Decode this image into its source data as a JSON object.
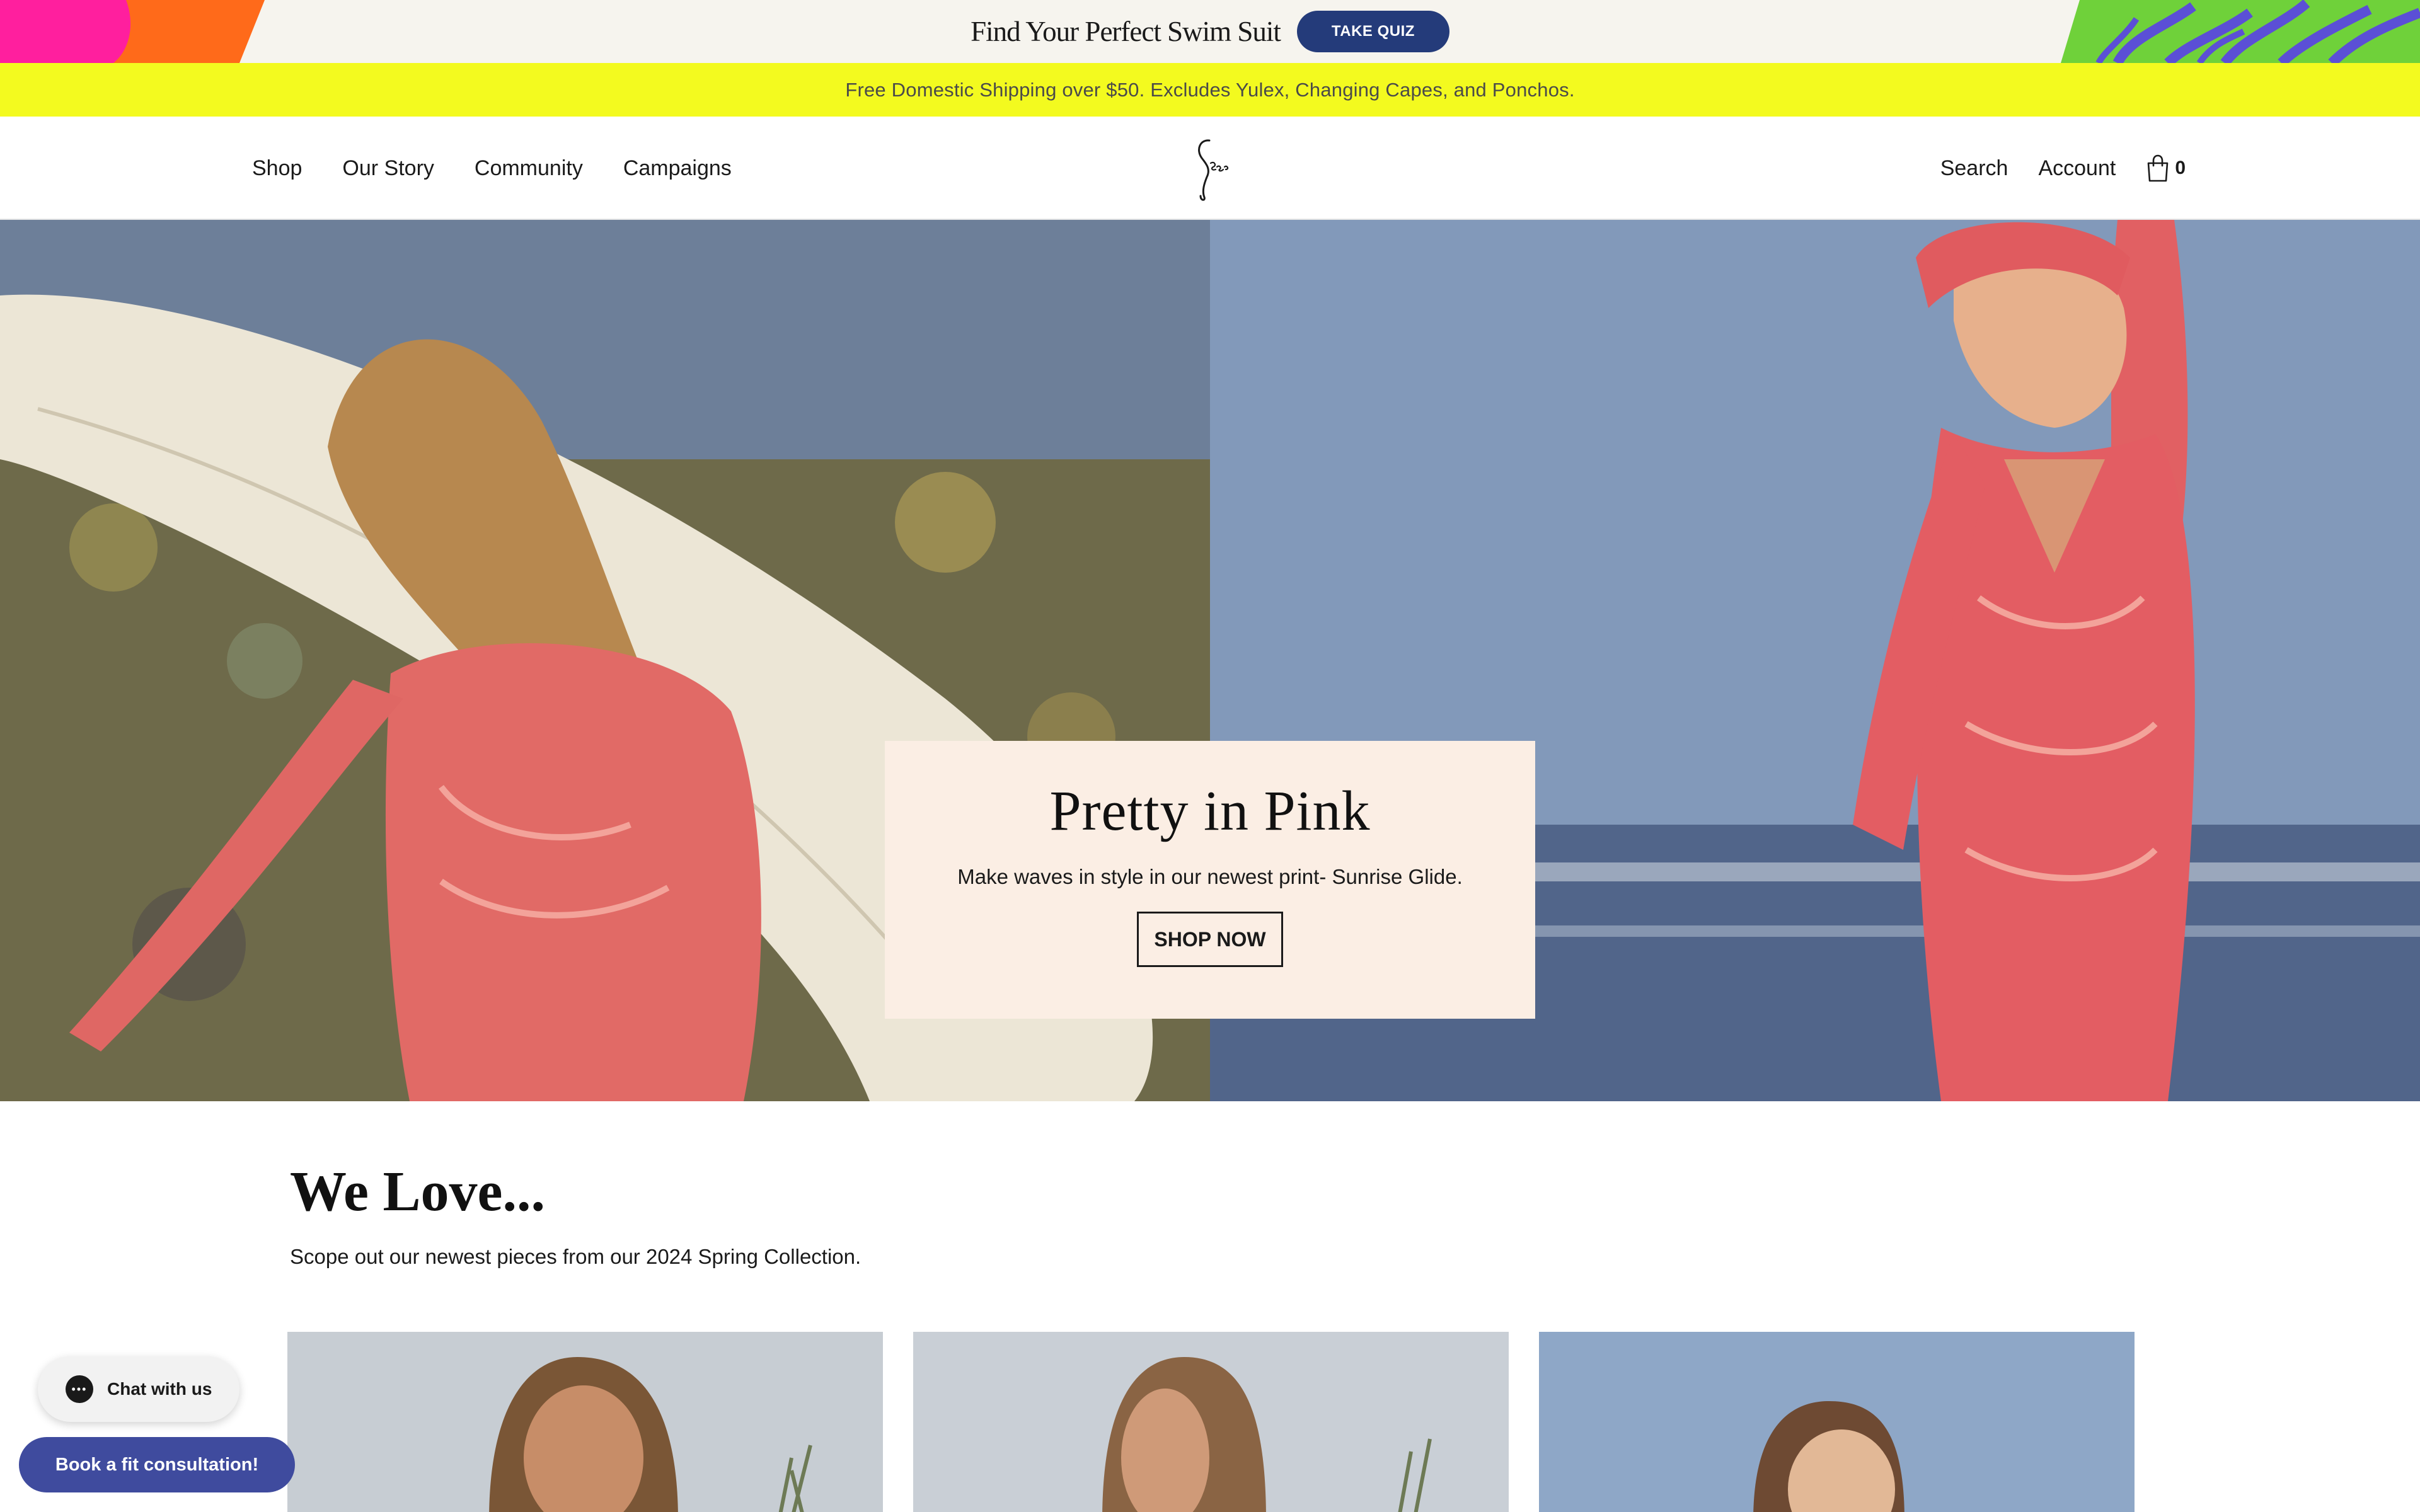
{
  "promo": {
    "title": "Find Your Perfect Swim Suit",
    "quiz_label": "TAKE QUIZ"
  },
  "shipping": {
    "text": "Free Domestic Shipping over $50. Excludes Yulex, Changing Capes, and Ponchos."
  },
  "header": {
    "nav_left": [
      "Shop",
      "Our Story",
      "Community",
      "Campaigns"
    ],
    "search_label": "Search",
    "account_label": "Account",
    "cart_count": "0",
    "logo_icon": "seea-signature-logo"
  },
  "hero": {
    "title": "Pretty in Pink",
    "subtitle": "Make waves in style in our newest print- Sunrise Glide.",
    "cta_label": "SHOP NOW"
  },
  "we_love": {
    "title": "We Love...",
    "subtitle": "Scope out our newest pieces from our 2024 Spring Collection."
  },
  "widgets": {
    "chat_label": "Chat with us",
    "consult_label": "Book a fit consultation!"
  },
  "colors": {
    "promo_bg": "#f6f4ee",
    "quiz_button": "#243b7a",
    "shipping_bar": "#f3fa1f",
    "hero_card": "#fbeee4",
    "consult_button": "#3f4b9e"
  }
}
